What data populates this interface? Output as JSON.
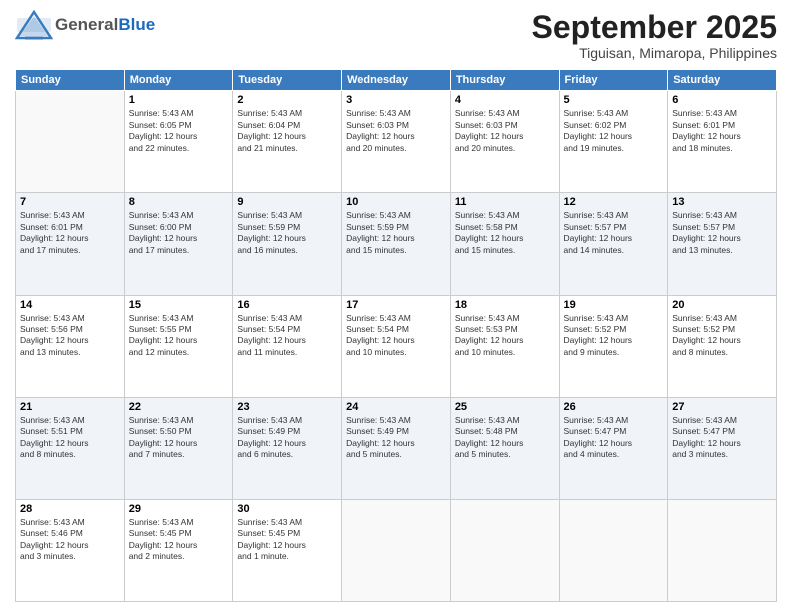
{
  "header": {
    "logo_general": "General",
    "logo_blue": "Blue",
    "month": "September 2025",
    "location": "Tiguisan, Mimaropa, Philippines"
  },
  "weekdays": [
    "Sunday",
    "Monday",
    "Tuesday",
    "Wednesday",
    "Thursday",
    "Friday",
    "Saturday"
  ],
  "weeks": [
    [
      {
        "day": "",
        "info": ""
      },
      {
        "day": "1",
        "info": "Sunrise: 5:43 AM\nSunset: 6:05 PM\nDaylight: 12 hours\nand 22 minutes."
      },
      {
        "day": "2",
        "info": "Sunrise: 5:43 AM\nSunset: 6:04 PM\nDaylight: 12 hours\nand 21 minutes."
      },
      {
        "day": "3",
        "info": "Sunrise: 5:43 AM\nSunset: 6:03 PM\nDaylight: 12 hours\nand 20 minutes."
      },
      {
        "day": "4",
        "info": "Sunrise: 5:43 AM\nSunset: 6:03 PM\nDaylight: 12 hours\nand 20 minutes."
      },
      {
        "day": "5",
        "info": "Sunrise: 5:43 AM\nSunset: 6:02 PM\nDaylight: 12 hours\nand 19 minutes."
      },
      {
        "day": "6",
        "info": "Sunrise: 5:43 AM\nSunset: 6:01 PM\nDaylight: 12 hours\nand 18 minutes."
      }
    ],
    [
      {
        "day": "7",
        "info": "Sunrise: 5:43 AM\nSunset: 6:01 PM\nDaylight: 12 hours\nand 17 minutes."
      },
      {
        "day": "8",
        "info": "Sunrise: 5:43 AM\nSunset: 6:00 PM\nDaylight: 12 hours\nand 17 minutes."
      },
      {
        "day": "9",
        "info": "Sunrise: 5:43 AM\nSunset: 5:59 PM\nDaylight: 12 hours\nand 16 minutes."
      },
      {
        "day": "10",
        "info": "Sunrise: 5:43 AM\nSunset: 5:59 PM\nDaylight: 12 hours\nand 15 minutes."
      },
      {
        "day": "11",
        "info": "Sunrise: 5:43 AM\nSunset: 5:58 PM\nDaylight: 12 hours\nand 15 minutes."
      },
      {
        "day": "12",
        "info": "Sunrise: 5:43 AM\nSunset: 5:57 PM\nDaylight: 12 hours\nand 14 minutes."
      },
      {
        "day": "13",
        "info": "Sunrise: 5:43 AM\nSunset: 5:57 PM\nDaylight: 12 hours\nand 13 minutes."
      }
    ],
    [
      {
        "day": "14",
        "info": "Sunrise: 5:43 AM\nSunset: 5:56 PM\nDaylight: 12 hours\nand 13 minutes."
      },
      {
        "day": "15",
        "info": "Sunrise: 5:43 AM\nSunset: 5:55 PM\nDaylight: 12 hours\nand 12 minutes."
      },
      {
        "day": "16",
        "info": "Sunrise: 5:43 AM\nSunset: 5:54 PM\nDaylight: 12 hours\nand 11 minutes."
      },
      {
        "day": "17",
        "info": "Sunrise: 5:43 AM\nSunset: 5:54 PM\nDaylight: 12 hours\nand 10 minutes."
      },
      {
        "day": "18",
        "info": "Sunrise: 5:43 AM\nSunset: 5:53 PM\nDaylight: 12 hours\nand 10 minutes."
      },
      {
        "day": "19",
        "info": "Sunrise: 5:43 AM\nSunset: 5:52 PM\nDaylight: 12 hours\nand 9 minutes."
      },
      {
        "day": "20",
        "info": "Sunrise: 5:43 AM\nSunset: 5:52 PM\nDaylight: 12 hours\nand 8 minutes."
      }
    ],
    [
      {
        "day": "21",
        "info": "Sunrise: 5:43 AM\nSunset: 5:51 PM\nDaylight: 12 hours\nand 8 minutes."
      },
      {
        "day": "22",
        "info": "Sunrise: 5:43 AM\nSunset: 5:50 PM\nDaylight: 12 hours\nand 7 minutes."
      },
      {
        "day": "23",
        "info": "Sunrise: 5:43 AM\nSunset: 5:49 PM\nDaylight: 12 hours\nand 6 minutes."
      },
      {
        "day": "24",
        "info": "Sunrise: 5:43 AM\nSunset: 5:49 PM\nDaylight: 12 hours\nand 5 minutes."
      },
      {
        "day": "25",
        "info": "Sunrise: 5:43 AM\nSunset: 5:48 PM\nDaylight: 12 hours\nand 5 minutes."
      },
      {
        "day": "26",
        "info": "Sunrise: 5:43 AM\nSunset: 5:47 PM\nDaylight: 12 hours\nand 4 minutes."
      },
      {
        "day": "27",
        "info": "Sunrise: 5:43 AM\nSunset: 5:47 PM\nDaylight: 12 hours\nand 3 minutes."
      }
    ],
    [
      {
        "day": "28",
        "info": "Sunrise: 5:43 AM\nSunset: 5:46 PM\nDaylight: 12 hours\nand 3 minutes."
      },
      {
        "day": "29",
        "info": "Sunrise: 5:43 AM\nSunset: 5:45 PM\nDaylight: 12 hours\nand 2 minutes."
      },
      {
        "day": "30",
        "info": "Sunrise: 5:43 AM\nSunset: 5:45 PM\nDaylight: 12 hours\nand 1 minute."
      },
      {
        "day": "",
        "info": ""
      },
      {
        "day": "",
        "info": ""
      },
      {
        "day": "",
        "info": ""
      },
      {
        "day": "",
        "info": ""
      }
    ]
  ]
}
